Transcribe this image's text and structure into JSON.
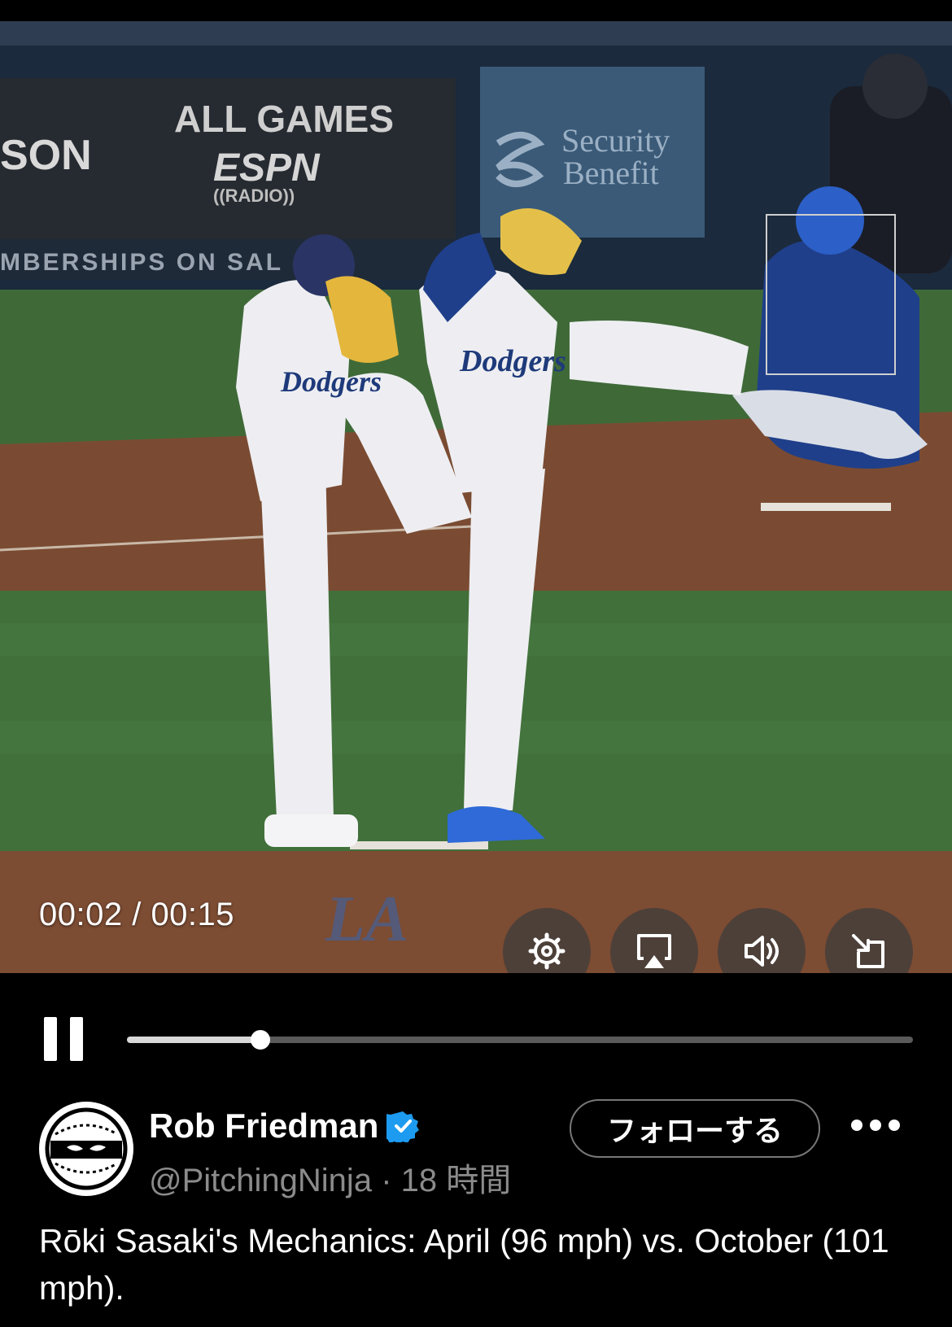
{
  "video": {
    "timecode": "00:02 / 00:15",
    "progress": 0.17,
    "buttons": {
      "settings_icon": "gear-icon",
      "airplay_icon": "airplay-icon",
      "volume_icon": "speaker-icon",
      "exit_fullscreen_icon": "minimize-icon"
    },
    "scene_text": {
      "banner_left": "SON",
      "banner_center_line1": "ALL GAMES",
      "banner_center_line2": "ESPN",
      "banner_center_line3": "((RADIO))",
      "banner_right_line1": "Security",
      "banner_right_line2": "Benefit",
      "ribbon": "MBERSHIPS ON SAL",
      "jersey": "Dodgers",
      "mound_logo": "LA"
    }
  },
  "controls": {
    "state": "playing",
    "pause_icon": "pause-icon"
  },
  "tweet": {
    "author_name": "Rob Friedman",
    "handle": "@PitchingNinja",
    "separator": "·",
    "time_ago": "18 時間",
    "follow_label": "フォローする",
    "more_icon": "more-icon",
    "text": "Rōki Sasaki's Mechanics: April (96 mph) vs. October (101 mph)."
  },
  "colors": {
    "background": "#000000",
    "verified": "#1d9bf0",
    "secondary_text": "#8b8b8b"
  }
}
